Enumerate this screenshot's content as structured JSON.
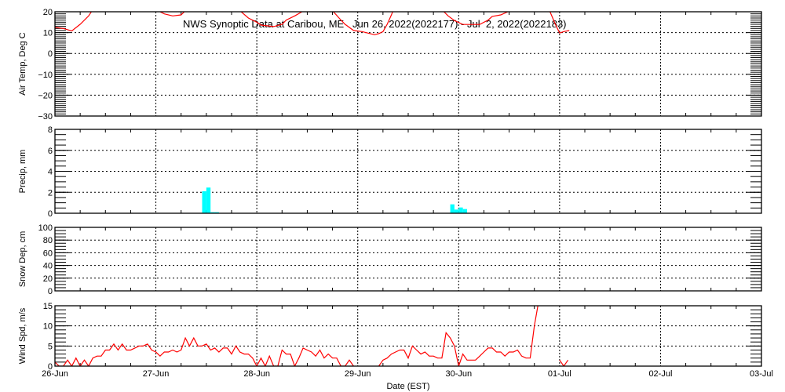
{
  "chart_data": {
    "type": "line",
    "title": "NWS Synoptic Data at Caribou, ME   Jun 26, 2022(2022177) - Jul  2, 2022(2022183)",
    "xlabel": "Date (EST)",
    "x_unit": "hours since 26-Jun 00:00",
    "x_range_hours": [
      0,
      168
    ],
    "x_tick_labels": [
      "26-Jun",
      "27-Jun",
      "28-Jun",
      "29-Jun",
      "30-Jun",
      "01-Jul",
      "02-Jul",
      "03-Jul"
    ],
    "colors": {
      "temp": "#ff0000",
      "precip": "#00ffff",
      "wind": "#ff0000",
      "axis": "#000000"
    },
    "panels": [
      {
        "id": "temp",
        "ylabel": "Air Temp, Deg C",
        "type": "line",
        "ylim": [
          -30,
          20
        ],
        "yticks": [
          -30,
          -20,
          -10,
          0,
          10,
          20
        ],
        "minor_step": 1,
        "points": [
          [
            0,
            12.5
          ],
          [
            2,
            12
          ],
          [
            4,
            10.8
          ],
          [
            6,
            14
          ],
          [
            8,
            18
          ],
          [
            9,
            21
          ],
          [
            12,
            26
          ],
          [
            18,
            25
          ],
          [
            23,
            21
          ],
          [
            24,
            21
          ],
          [
            26,
            19
          ],
          [
            28,
            18
          ],
          [
            30,
            18.5
          ],
          [
            31,
            20.5
          ],
          [
            34,
            25
          ],
          [
            40,
            26
          ],
          [
            44,
            20.5
          ],
          [
            46,
            17
          ],
          [
            48,
            15
          ],
          [
            49,
            13.6
          ],
          [
            52,
            12.9
          ],
          [
            54,
            14
          ],
          [
            55,
            16
          ],
          [
            57,
            18
          ],
          [
            59,
            20.3
          ],
          [
            62,
            25
          ],
          [
            66,
            20.5
          ],
          [
            68,
            16
          ],
          [
            69,
            14
          ],
          [
            71,
            11
          ],
          [
            73,
            10.5
          ],
          [
            76,
            9
          ],
          [
            77,
            9.5
          ],
          [
            78,
            10.5
          ],
          [
            79,
            14
          ],
          [
            80,
            18.5
          ],
          [
            80.5,
            21
          ],
          [
            86,
            26
          ],
          [
            92,
            21
          ],
          [
            93.5,
            18
          ],
          [
            95,
            15.8
          ],
          [
            97,
            13.9
          ],
          [
            101,
            13.9
          ],
          [
            103,
            16
          ],
          [
            104,
            17.8
          ],
          [
            106,
            18.5
          ],
          [
            108,
            20.3
          ],
          [
            112,
            26
          ],
          [
            117.5,
            21
          ],
          [
            119,
            14
          ],
          [
            120,
            9.8
          ],
          [
            121,
            10.5
          ],
          [
            122.3,
            11
          ]
        ]
      },
      {
        "id": "precip",
        "ylabel": "Precip, mm",
        "type": "bar",
        "ylim": [
          0,
          8
        ],
        "yticks": [
          0,
          2,
          4,
          6,
          8
        ],
        "minor_step": 0.5,
        "bars": [
          [
            35,
            2.1
          ],
          [
            36,
            2.45
          ],
          [
            37,
            0.1
          ],
          [
            38,
            0.1
          ],
          [
            94,
            0.85
          ],
          [
            95,
            0.35
          ],
          [
            96,
            0.55
          ],
          [
            97,
            0.4
          ]
        ]
      },
      {
        "id": "snow",
        "ylabel": "Snow Dep, cm",
        "type": "line",
        "ylim": [
          0,
          100
        ],
        "yticks": [
          0,
          20,
          40,
          60,
          80,
          100
        ],
        "minor_step": 5,
        "points": []
      },
      {
        "id": "wind",
        "ylabel": "Wind Spd, m/s",
        "type": "line",
        "ylim": [
          0,
          15
        ],
        "yticks": [
          0,
          5,
          10,
          15
        ],
        "minor_step": 1,
        "hourly_start": 0,
        "hourly": [
          1,
          0,
          0,
          1.5,
          0,
          2,
          0,
          1.5,
          0,
          2,
          2.5,
          2.5,
          4,
          4,
          5.5,
          4,
          5.5,
          4,
          4,
          4.5,
          5,
          5,
          5.5,
          4,
          3.5,
          2.5,
          3.5,
          3.5,
          4,
          3.5,
          4,
          7,
          5,
          7,
          5,
          5,
          5.5,
          4,
          4.5,
          3.5,
          4.5,
          4.5,
          3,
          5,
          3.5,
          3,
          3,
          2,
          0,
          2,
          0,
          2.5,
          0,
          0,
          4,
          3,
          3,
          0,
          2,
          4.5,
          4,
          3.5,
          2.5,
          4,
          2,
          3,
          2,
          2,
          0,
          0,
          1.5,
          0,
          null,
          null,
          null,
          null,
          null,
          0,
          1.5,
          2,
          3,
          3.5,
          4,
          4,
          2,
          5,
          4,
          3,
          3.5,
          2.5,
          2.5,
          2,
          2,
          8.3,
          7,
          5,
          0,
          3,
          1.5,
          1.5,
          1.5,
          2.5,
          3.5,
          4.5,
          4.5,
          3.5,
          3.5,
          2.5,
          3.5,
          3.5,
          4,
          2.5,
          2,
          2,
          10,
          16,
          null,
          null,
          null,
          null,
          1.5,
          0,
          1.5
        ]
      }
    ]
  }
}
